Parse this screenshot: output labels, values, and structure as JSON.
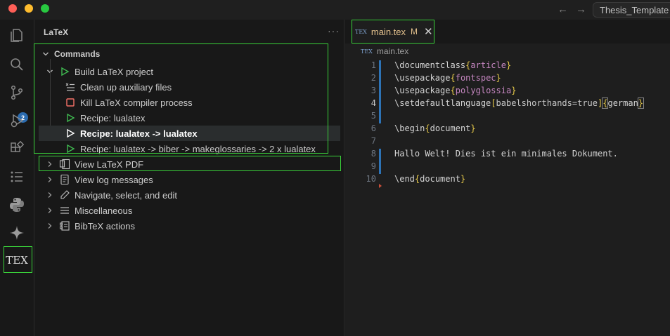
{
  "window": {
    "command_center": "Thesis_Template"
  },
  "activity_bar": {
    "scm_badge": "2",
    "latex_label": "TEX"
  },
  "sidebar": {
    "title": "LaTeX",
    "commands": {
      "header": "Commands",
      "build": {
        "label": "Build LaTeX project",
        "children": [
          {
            "label": "Clean up auxiliary files",
            "icon": "clean-icon"
          },
          {
            "label": "Kill LaTeX compiler process",
            "icon": "stop-icon"
          },
          {
            "label": "Recipe: lualatex",
            "icon": "play-icon"
          },
          {
            "label": "Recipe: lualatex -> lualatex",
            "icon": "play-icon"
          },
          {
            "label": "Recipe: lualatex -> biber -> makeglossaries -> 2 x lualatex",
            "icon": "play-icon"
          }
        ]
      },
      "groups": [
        {
          "label": "View LaTeX PDF",
          "icon": "pdf-view-icon"
        },
        {
          "label": "View log messages",
          "icon": "log-icon"
        },
        {
          "label": "Navigate, select, and edit",
          "icon": "edit-icon"
        },
        {
          "label": "Miscellaneous",
          "icon": "menu-icon"
        },
        {
          "label": "BibTeX actions",
          "icon": "bibtex-icon"
        }
      ]
    }
  },
  "editor": {
    "tab": {
      "label": "main.tex",
      "status": "M",
      "icon_label": "TEX"
    },
    "breadcrumb": "main.tex",
    "line_numbers": [
      "1",
      "2",
      "3",
      "4",
      "5",
      "6",
      "7",
      "8",
      "9",
      "10"
    ],
    "lines": [
      {
        "cmd": "\\documentclass",
        "open": "{",
        "arg": "article",
        "close": "}"
      },
      {
        "cmd": "\\usepackage",
        "open": "{",
        "arg": "fontspec",
        "close": "}"
      },
      {
        "cmd": "\\usepackage",
        "open": "{",
        "arg": "polyglossia",
        "close": "}"
      },
      {
        "cmd": "\\setdefaultlanguage",
        "opt_open": "[",
        "opt": "babelshorthands=true",
        "opt_close": "]",
        "open": "{",
        "arg": "german",
        "close": "}"
      },
      {
        "text": ""
      },
      {
        "cmd": "\\begin",
        "open": "{",
        "arg": "document",
        "close": "}"
      },
      {
        "text": ""
      },
      {
        "text": "Hallo Welt! Dies ist ein minimales Dokument."
      },
      {
        "text": ""
      },
      {
        "cmd": "\\end",
        "open": "{",
        "arg": "document",
        "close": "}"
      }
    ]
  },
  "colors": {
    "accent": "#3ad33a",
    "play": "#3fb950",
    "stop": "#f47067",
    "badge": "#2b6cb0"
  }
}
